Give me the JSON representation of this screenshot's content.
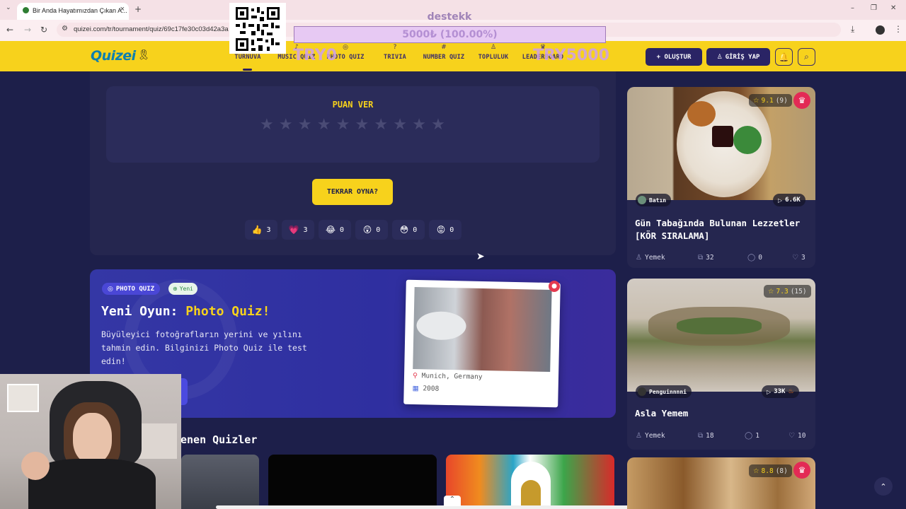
{
  "browser": {
    "tab_title": "Bir Anda Hayatımızdan Çıkan A...",
    "tab_close": "×",
    "new_tab": "+",
    "url": "quizei.com/tr/tournament/quiz/69c17fe30c03d42a3a",
    "window_controls": [
      "–",
      "❐",
      "✕"
    ]
  },
  "overlay": {
    "donation_label": "destekk",
    "donation_progress": "5000₺ (100.00%)",
    "donation_fraction": 1.0,
    "try_left": "TRY0",
    "try_right": "TRY5000"
  },
  "site": {
    "logo": "Quizei",
    "nav": [
      {
        "icon": "trophy-icon",
        "glyph": "",
        "label": "TURNUVA"
      },
      {
        "icon": "music-icon",
        "glyph": "♪",
        "label": "MUSIC QUIZ"
      },
      {
        "icon": "camera-icon",
        "glyph": "◎",
        "label": "PHOTO QUIZ"
      },
      {
        "icon": "question-icon",
        "glyph": "?",
        "label": "TRIVIA"
      },
      {
        "icon": "hash-icon",
        "glyph": "#",
        "label": "NUMBER QUIZ"
      },
      {
        "icon": "users-icon",
        "glyph": "♙",
        "label": "TOPLULUK"
      },
      {
        "icon": "crown-icon",
        "glyph": "♛",
        "label": "LEADERBOARD"
      }
    ],
    "create_button": "+ OLUŞTUR",
    "login_button": "GİRİŞ YAP"
  },
  "rating": {
    "title": "PUAN VER",
    "star_count": 10,
    "replay_button": "TEKRAR OYNA?",
    "reactions": [
      {
        "emoji": "👍",
        "icon": "thumbs-up-icon",
        "count": "3"
      },
      {
        "emoji": "💗",
        "icon": "heart-icon",
        "count": "3"
      },
      {
        "emoji": "😂",
        "icon": "laugh-icon",
        "count": "0"
      },
      {
        "emoji": "😲",
        "icon": "wow-icon",
        "count": "0"
      },
      {
        "emoji": "😳",
        "icon": "flushed-icon",
        "count": "0"
      },
      {
        "emoji": "😡",
        "icon": "angry-icon",
        "count": "0"
      }
    ]
  },
  "promo": {
    "badge": "PHOTO QUIZ",
    "new_badge": "Yeni",
    "title_prefix": "Yeni Oyun: ",
    "title_accent": "Photo Quiz!",
    "description": "Büyüleyici fotoğrafların yerini ve yılını tahmin edin. Bilginizi Photo Quiz ile test edin!",
    "polaroid_city": "Munich, Germany",
    "polaroid_year": "2008"
  },
  "section_title": "enen Quizler",
  "sidebar": [
    {
      "rating": "9.1",
      "rating_count": "(9)",
      "author": "Batın",
      "plays": "6.6K",
      "title": "Gün Tabağında Bulunan Lezzetler [KÖR SIRALAMA]",
      "category": "Yemek",
      "items": "32",
      "comments": "0",
      "likes": "3",
      "crowned": true
    },
    {
      "rating": "7.3",
      "rating_count": "(15)",
      "author": "Penguinnnni",
      "plays": "33K",
      "title": "Asla Yemem",
      "category": "Yemek",
      "items": "18",
      "comments": "1",
      "likes": "10",
      "crowned": false
    },
    {
      "rating": "8.8",
      "rating_count": "(8)",
      "crowned": true
    }
  ],
  "colors": {
    "accent": "#f7d21c",
    "bg": "#1d1f4a",
    "card": "#25264f",
    "brand": "#0d7fb0",
    "crown": "#e32a55"
  }
}
